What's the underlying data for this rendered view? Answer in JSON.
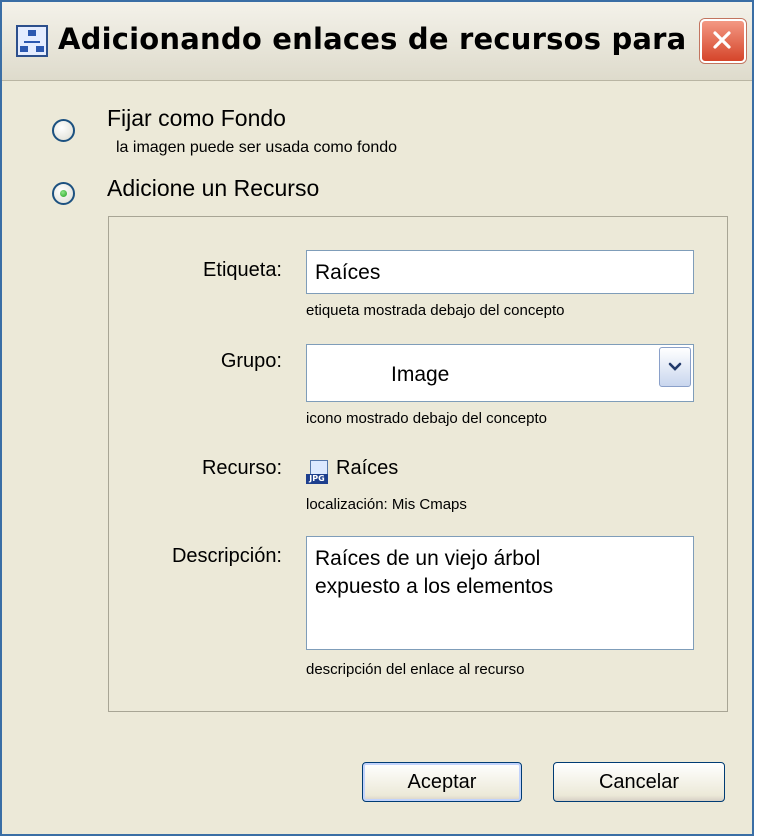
{
  "window": {
    "title": "Adicionando enlaces de recursos para [..."
  },
  "options": {
    "background": {
      "label": "Fijar como Fondo",
      "hint": "la imagen puede ser usada como fondo",
      "selected": false
    },
    "resource": {
      "label": "Adicione un Recurso",
      "selected": true
    }
  },
  "form": {
    "label_field": {
      "label": "Etiqueta:",
      "value": "Raíces",
      "hint": "etiqueta mostrada debajo del concepto"
    },
    "group": {
      "label": "Grupo:",
      "value": "Image",
      "hint": "icono mostrado debajo del concepto"
    },
    "resource": {
      "label": "Recurso:",
      "name": "Raíces",
      "icon": "jpg-file-icon",
      "location": "localización: Mis Cmaps"
    },
    "description": {
      "label": "Descripción:",
      "line1": "Raíces de un viejo árbol",
      "line2": "expuesto a los elementos",
      "hint": "descripción del enlace al recurso"
    }
  },
  "buttons": {
    "accept": "Aceptar",
    "cancel": "Cancelar"
  },
  "colors": {
    "dialog_bg": "#ece9d8",
    "close_button": "#d5452a",
    "radio_selected": "#21a121"
  }
}
